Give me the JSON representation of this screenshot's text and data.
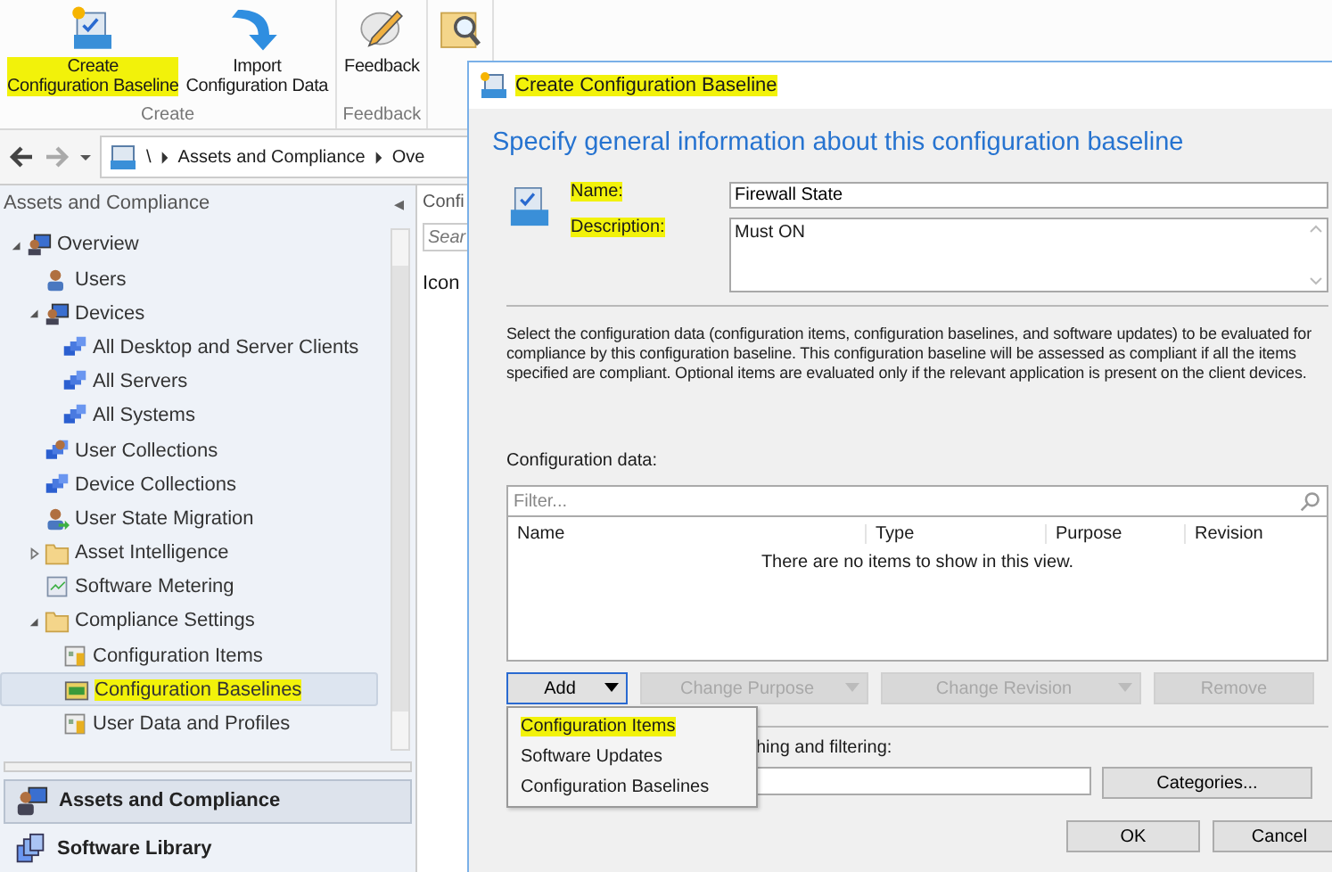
{
  "ribbon": {
    "groups": [
      {
        "label": "Create",
        "buttons": [
          {
            "kind": "baseline",
            "lines": [
              "Create",
              "Configuration Baseline"
            ],
            "highlighted": true
          },
          {
            "kind": "import",
            "lines": [
              "Import",
              "Configuration Data"
            ],
            "highlighted": false
          }
        ]
      },
      {
        "label": "Feedback",
        "buttons": [
          {
            "kind": "feedback",
            "lines": [
              "Feedback"
            ],
            "highlighted": false
          }
        ]
      },
      {
        "buttons": [
          {
            "kind": "search"
          }
        ]
      }
    ]
  },
  "address_bar": {
    "segments": [
      "\\",
      "Assets and Compliance",
      "Ove"
    ]
  },
  "navigation": {
    "title": "Assets and Compliance",
    "collapse": "◂",
    "tree": [
      {
        "label": "Overview",
        "kind": "overview",
        "expanded": true,
        "selected": false,
        "highlighted": false,
        "children": [
          {
            "label": "Users",
            "kind": "user",
            "selected": false,
            "highlighted": false
          },
          {
            "label": "Devices",
            "kind": "devices",
            "expanded": true,
            "selected": false,
            "highlighted": false,
            "children": [
              {
                "label": "All Desktop and Server Clients",
                "kind": "collection",
                "selected": false,
                "highlighted": false
              },
              {
                "label": "All Servers",
                "kind": "collection",
                "selected": false,
                "highlighted": false
              },
              {
                "label": "All Systems",
                "kind": "collection",
                "selected": false,
                "highlighted": false
              }
            ]
          },
          {
            "label": "User Collections",
            "kind": "usercollection",
            "selected": false,
            "highlighted": false
          },
          {
            "label": "Device Collections",
            "kind": "collection",
            "selected": false,
            "highlighted": false
          },
          {
            "label": "User State Migration",
            "kind": "migration",
            "selected": false,
            "highlighted": false
          },
          {
            "label": "Asset Intelligence",
            "kind": "folder",
            "expanded": false,
            "selected": false,
            "highlighted": false
          },
          {
            "label": "Software Metering",
            "kind": "document",
            "selected": false,
            "highlighted": false
          },
          {
            "label": "Compliance Settings",
            "kind": "folder",
            "expanded": true,
            "selected": false,
            "highlighted": false,
            "children": [
              {
                "label": "Configuration Items",
                "kind": "settings",
                "selected": false,
                "highlighted": false
              },
              {
                "label": "Configuration Baselines",
                "kind": "baseline",
                "selected": true,
                "highlighted": true
              },
              {
                "label": "User Data and Profiles",
                "kind": "settings",
                "selected": false,
                "highlighted": false
              }
            ]
          }
        ]
      }
    ]
  },
  "workspaces": [
    {
      "label": "Assets and Compliance",
      "kind": "assets",
      "selected": true
    },
    {
      "label": "Software Library",
      "kind": "library",
      "selected": false
    }
  ],
  "content": {
    "header": "Confi",
    "search": {
      "placeholder": "Sear"
    },
    "column": "Icon"
  },
  "dialog": {
    "title": "Create Configuration Baseline",
    "title_highlighted": true,
    "heading": "Specify general information about this configuration baseline",
    "fields": [
      {
        "label": "Name:",
        "value": "Firewall State",
        "kind": "text",
        "highlighted": true
      },
      {
        "label": "Description:",
        "value": "Must ON",
        "kind": "multiline",
        "highlighted": true
      }
    ],
    "explanation": "Select the configuration data (configuration items, configuration baselines, and software updates) to be evaluated for compliance by this configuration baseline. This configuration baseline will be assessed as compliant if all the items specified are compliant. Optional items are evaluated only if the relevant application is present on  the client devices.",
    "data_label": "Configuration data:",
    "filter": {
      "placeholder": "Filter..."
    },
    "table": {
      "columns": [
        "Name",
        "Type",
        "Purpose",
        "Revision"
      ],
      "empty": "There are no items to show in this view."
    },
    "actions": [
      {
        "label": "Add",
        "dropdown": true,
        "disabled": false
      },
      {
        "label": "Change Purpose",
        "dropdown": true,
        "disabled": true
      },
      {
        "label": "Change Revision",
        "dropdown": true,
        "disabled": true
      },
      {
        "label": "Remove",
        "dropdown": false,
        "disabled": true
      }
    ],
    "add_menu": [
      {
        "label": "Configuration Items",
        "highlighted": true
      },
      {
        "label": "Software Updates",
        "highlighted": false
      },
      {
        "label": "Configuration Baselines",
        "highlighted": false
      }
    ],
    "categories_label": "hing and filtering:",
    "categories_button": "Categories...",
    "buttons": [
      "OK",
      "Cancel"
    ]
  }
}
